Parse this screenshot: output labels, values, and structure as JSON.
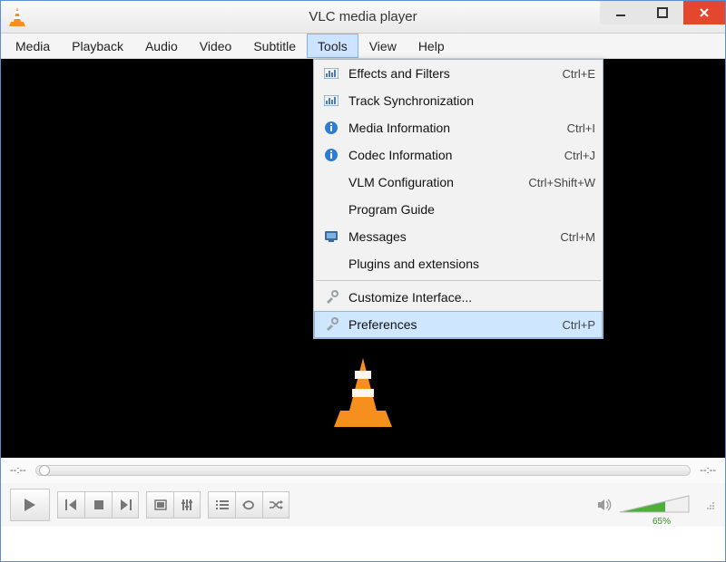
{
  "window": {
    "title": "VLC media player"
  },
  "menubar": {
    "items": [
      "Media",
      "Playback",
      "Audio",
      "Video",
      "Subtitle",
      "Tools",
      "View",
      "Help"
    ],
    "openIndex": 5
  },
  "tools_menu": {
    "items": [
      {
        "icon": "equalizer-icon",
        "label": "Effects and Filters",
        "shortcut": "Ctrl+E"
      },
      {
        "icon": "equalizer-icon",
        "label": "Track Synchronization",
        "shortcut": ""
      },
      {
        "icon": "info-icon",
        "label": "Media Information",
        "shortcut": "Ctrl+I"
      },
      {
        "icon": "info-icon",
        "label": "Codec Information",
        "shortcut": "Ctrl+J"
      },
      {
        "icon": "",
        "label": "VLM Configuration",
        "shortcut": "Ctrl+Shift+W"
      },
      {
        "icon": "",
        "label": "Program Guide",
        "shortcut": ""
      },
      {
        "icon": "monitor-icon",
        "label": "Messages",
        "shortcut": "Ctrl+M"
      },
      {
        "icon": "",
        "label": "Plugins and extensions",
        "shortcut": ""
      },
      {
        "sep": true
      },
      {
        "icon": "tools-icon",
        "label": "Customize Interface...",
        "shortcut": ""
      },
      {
        "icon": "tools-icon",
        "label": "Preferences",
        "shortcut": "Ctrl+P",
        "hover": true
      }
    ]
  },
  "seek": {
    "elapsed": "--:--",
    "total": "--:--"
  },
  "volume": {
    "percent": "65%"
  }
}
